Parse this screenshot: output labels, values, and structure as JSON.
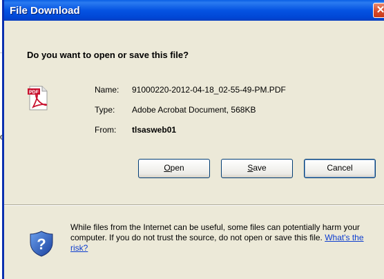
{
  "window": {
    "title": "File Download"
  },
  "background": {
    "text_fragment": "oi"
  },
  "dialog": {
    "question": "Do you want to open or save this file?",
    "file_icon": "pdf-icon",
    "fields": {
      "name_label": "Name:",
      "name_value": "91000220-2012-04-18_02-55-49-PM.PDF",
      "type_label": "Type:",
      "type_value": "Adobe Acrobat Document, 568KB",
      "from_label": "From:",
      "from_value": "tlsasweb01"
    },
    "buttons": {
      "open": {
        "access_key": "O",
        "rest": "pen"
      },
      "save": {
        "access_key": "S",
        "rest": "ave"
      },
      "cancel": "Cancel"
    },
    "warning": {
      "icon": "shield-question-icon",
      "text": "While files from the Internet can be useful, some files can potentially harm your computer. If you do not trust the source, do not open or save this file.",
      "link": "What's the risk?"
    }
  },
  "colors": {
    "titlebar": "#0553e2",
    "dialog_bg": "#ece9d8",
    "link": "#0b3ccf",
    "close": "#d84a2a"
  }
}
